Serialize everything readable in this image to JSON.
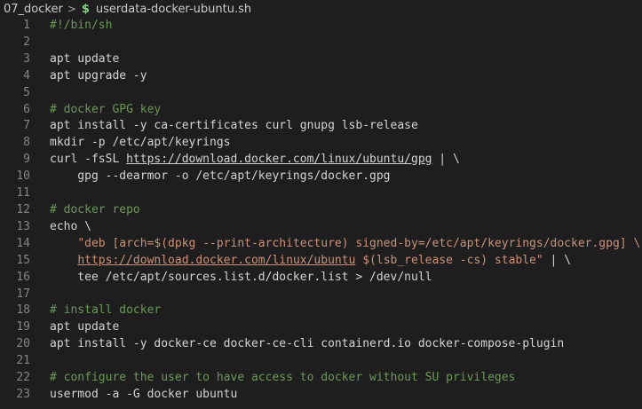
{
  "breadcrumb": {
    "folder": "07_docker",
    "separator": ">",
    "file_icon": "$",
    "file": "userdata-docker-ubuntu.sh"
  },
  "editor": {
    "lines": [
      {
        "n": "1",
        "segs": [
          {
            "t": "#!/bin/sh",
            "c": "comment"
          }
        ]
      },
      {
        "n": "2",
        "segs": []
      },
      {
        "n": "3",
        "segs": [
          {
            "t": "apt update",
            "c": "plain"
          }
        ]
      },
      {
        "n": "4",
        "segs": [
          {
            "t": "apt upgrade -y",
            "c": "plain"
          }
        ]
      },
      {
        "n": "5",
        "segs": []
      },
      {
        "n": "6",
        "segs": [
          {
            "t": "# docker GPG key",
            "c": "comment"
          }
        ]
      },
      {
        "n": "7",
        "segs": [
          {
            "t": "apt install -y ca-certificates curl gnupg lsb-release",
            "c": "plain"
          }
        ]
      },
      {
        "n": "8",
        "segs": [
          {
            "t": "mkdir -p /etc/apt/keyrings",
            "c": "plain"
          }
        ]
      },
      {
        "n": "9",
        "segs": [
          {
            "t": "curl -fsSL ",
            "c": "plain"
          },
          {
            "t": "https://download.docker.com/linux/ubuntu/gpg",
            "c": "link"
          },
          {
            "t": " | \\",
            "c": "plain"
          }
        ]
      },
      {
        "n": "10",
        "segs": [
          {
            "t": "    gpg --dearmor -o /etc/apt/keyrings/docker.gpg",
            "c": "plain"
          }
        ]
      },
      {
        "n": "11",
        "segs": []
      },
      {
        "n": "12",
        "segs": [
          {
            "t": "# docker repo",
            "c": "comment"
          }
        ]
      },
      {
        "n": "13",
        "segs": [
          {
            "t": "echo \\",
            "c": "plain"
          }
        ]
      },
      {
        "n": "14",
        "segs": [
          {
            "t": "    ",
            "c": "plain"
          },
          {
            "t": "\"deb [arch=$(dpkg --print-architecture) signed-by=/etc/apt/keyrings/docker.gpg] \\",
            "c": "string"
          }
        ]
      },
      {
        "n": "15",
        "segs": [
          {
            "t": "    ",
            "c": "plain"
          },
          {
            "t": "https://download.docker.com/linux/ubuntu",
            "c": "url"
          },
          {
            "t": " $(lsb_release -cs) stable\"",
            "c": "string"
          },
          {
            "t": " | \\",
            "c": "plain"
          }
        ]
      },
      {
        "n": "16",
        "segs": [
          {
            "t": "    tee /etc/apt/sources.list.d/docker.list > /dev/null",
            "c": "plain"
          }
        ]
      },
      {
        "n": "17",
        "segs": []
      },
      {
        "n": "18",
        "segs": [
          {
            "t": "# install docker",
            "c": "comment"
          }
        ]
      },
      {
        "n": "19",
        "segs": [
          {
            "t": "apt update",
            "c": "plain"
          }
        ]
      },
      {
        "n": "20",
        "segs": [
          {
            "t": "apt install -y docker-ce docker-ce-cli containerd.io docker-compose-plugin",
            "c": "plain"
          }
        ]
      },
      {
        "n": "21",
        "segs": []
      },
      {
        "n": "22",
        "segs": [
          {
            "t": "# configure the user to have access to docker without SU privileges",
            "c": "comment"
          }
        ]
      },
      {
        "n": "23",
        "segs": [
          {
            "t": "usermod -a -G docker ubuntu",
            "c": "plain"
          }
        ]
      }
    ]
  },
  "colors": {
    "background": "#1e1e1e",
    "text": "#d4d4d4",
    "comment": "#6a9955",
    "string": "#ce9178",
    "line_number": "#858585",
    "shell_icon": "#89d185"
  }
}
